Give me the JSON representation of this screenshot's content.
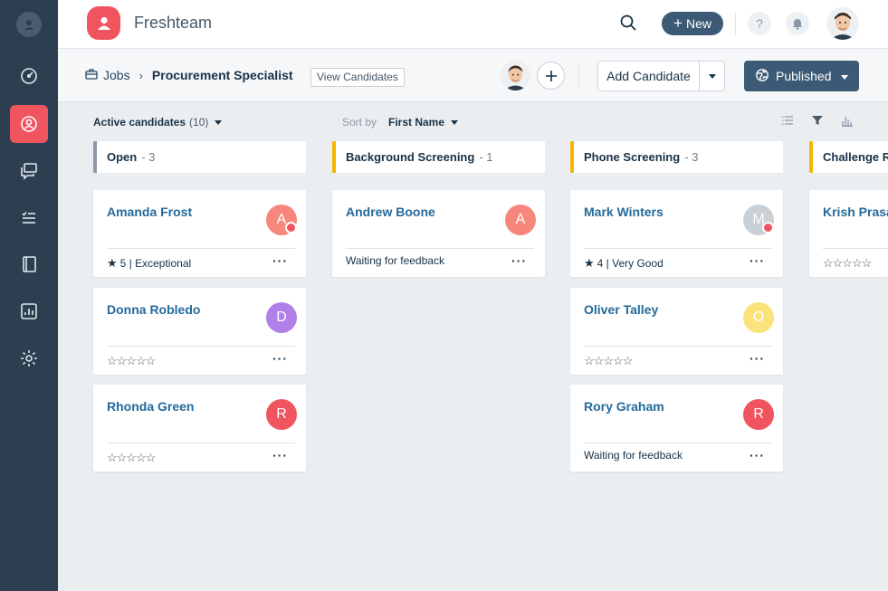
{
  "app": {
    "name": "Freshteam"
  },
  "header": {
    "new_label": "New",
    "help_label": "?"
  },
  "breadcrumb": {
    "jobs": "Jobs",
    "separator": "›",
    "title": "Procurement Specialist",
    "view_candidates": "View Candidates"
  },
  "actions": {
    "add_candidate": "Add Candidate",
    "published": "Published"
  },
  "filters": {
    "active_label": "Active candidates",
    "active_count": "(10)",
    "sort_label": "Sort by",
    "sort_value": "First Name"
  },
  "columns": [
    {
      "title": "Open",
      "count": "- 3",
      "color": "#8a99a8"
    },
    {
      "title": "Background Screening",
      "count": "- 1",
      "color": "#f5b400"
    },
    {
      "title": "Phone Screening",
      "count": "- 3",
      "color": "#f5b400"
    },
    {
      "title": "Challenge Ro",
      "count": "",
      "color": "#f5b400"
    }
  ],
  "cards": [
    {
      "name": "Amanda Frost",
      "initial": "A",
      "avatar_color": "#f7877d",
      "foot": "5 | Exceptional",
      "rating": 5,
      "more": "···"
    },
    {
      "name": "Donna Robledo",
      "initial": "D",
      "avatar_color": "#b07fe8",
      "foot": "☆☆☆☆☆",
      "more": "···"
    },
    {
      "name": "Rhonda Green",
      "initial": "R",
      "avatar_color": "#f0545e",
      "foot": "☆☆☆☆☆",
      "more": "···"
    },
    {
      "name": "Andrew Boone",
      "initial": "A",
      "avatar_color": "#f7877d",
      "foot": "Waiting for feedback",
      "more": "···"
    },
    {
      "name": "Mark Winters",
      "initial": "M",
      "avatar_color": "#c9d0d6",
      "foot": "4 | Very Good",
      "rating": 4,
      "more": "···"
    },
    {
      "name": "Oliver Talley",
      "initial": "O",
      "avatar_color": "#fbe27a",
      "foot": "☆☆☆☆☆",
      "more": "···"
    },
    {
      "name": "Rory Graham",
      "initial": "R",
      "avatar_color": "#f0545e",
      "foot": "Waiting for feedback",
      "more": "···"
    },
    {
      "name": "Krish Prasa",
      "foot": "☆☆☆☆☆"
    }
  ],
  "icons": {
    "sidebar": [
      "dashboard-icon",
      "candidates-icon",
      "chat-icon",
      "tasks-icon",
      "book-icon",
      "reports-icon",
      "settings-icon"
    ]
  },
  "colors": {
    "accent": "#f0545e",
    "sidebar": "#2c3e50",
    "primary_button": "#3c5a75",
    "link": "#246a9b"
  }
}
